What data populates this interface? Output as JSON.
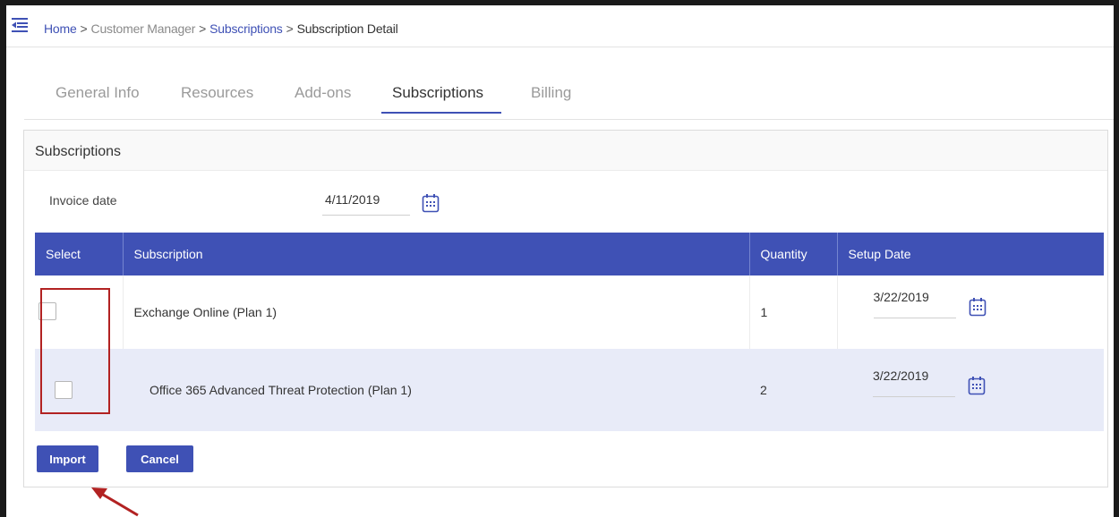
{
  "breadcrumb": {
    "home": "Home",
    "separator": ">",
    "customer_manager": "Customer Manager",
    "subscriptions": "Subscriptions",
    "current": "Subscription Detail"
  },
  "tabs": [
    {
      "label": "General Info",
      "active": false
    },
    {
      "label": "Resources",
      "active": false
    },
    {
      "label": "Add-ons",
      "active": false
    },
    {
      "label": "Subscriptions",
      "active": true
    },
    {
      "label": "Billing",
      "active": false
    }
  ],
  "card": {
    "title": "Subscriptions",
    "invoice_label": "Invoice date",
    "invoice_date": "4/11/2019"
  },
  "table": {
    "headers": {
      "select": "Select",
      "subscription": "Subscription",
      "quantity": "Quantity",
      "setup_date": "Setup Date"
    },
    "rows": [
      {
        "checked": false,
        "subscription": "Exchange Online (Plan 1)",
        "quantity": "1",
        "setup_date": "3/22/2019"
      },
      {
        "checked": false,
        "subscription": "Office 365 Advanced Threat Protection (Plan 1)",
        "quantity": "2",
        "setup_date": "3/22/2019"
      }
    ]
  },
  "buttons": {
    "import": "Import",
    "cancel": "Cancel"
  },
  "colors": {
    "accent": "#3f51b5",
    "row_highlight": "#e8ebf8",
    "annotation": "#b22222"
  },
  "icons": {
    "menu": "menu-collapse-icon",
    "calendar": "calendar-icon",
    "annotation_arrow": "arrow-icon"
  }
}
